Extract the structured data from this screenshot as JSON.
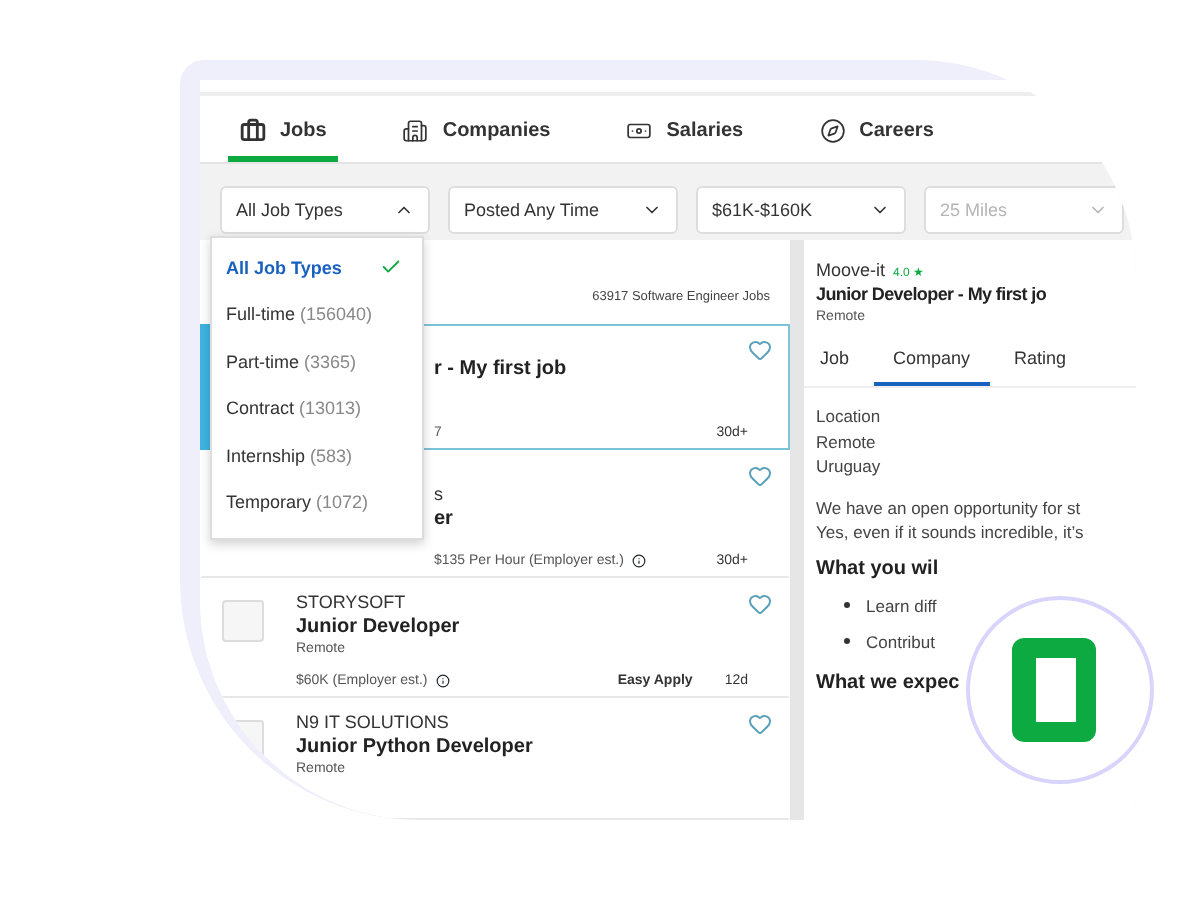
{
  "nav_tabs": [
    {
      "label": "Jobs",
      "selected": true
    },
    {
      "label": "Companies",
      "selected": false
    },
    {
      "label": "Salaries",
      "selected": false
    },
    {
      "label": "Careers",
      "selected": false
    }
  ],
  "filters": [
    {
      "label": "All Job Types",
      "expanded": true,
      "disabled": false
    },
    {
      "label": "Posted Any Time",
      "expanded": false,
      "disabled": false
    },
    {
      "label": "$61K-$160K",
      "expanded": false,
      "disabled": false
    },
    {
      "label": "25 Miles",
      "expanded": false,
      "disabled": true
    }
  ],
  "job_type_menu": [
    {
      "label": "All Job Types",
      "selected": true
    },
    {
      "label": "Full-time",
      "count": "(156040)",
      "selected": false
    },
    {
      "label": "Part-time",
      "count": "(3365)",
      "selected": false
    },
    {
      "label": "Contract",
      "count": "(13013)",
      "selected": false
    },
    {
      "label": "Internship",
      "count": "(583)",
      "selected": false
    },
    {
      "label": "Temporary",
      "count": "(1072)",
      "selected": false
    }
  ],
  "results_count": "63917 Software Engineer Jobs",
  "jobs": [
    {
      "covered": true,
      "selected": true,
      "title": "r - My first job",
      "salary": "7",
      "age": "30d+"
    },
    {
      "covered": true,
      "selected": false,
      "company": "s",
      "title": "er",
      "salary": "$135 Per Hour (Employer est.)",
      "age": "30d+"
    },
    {
      "covered": false,
      "selected": false,
      "company": "STORYSOFT",
      "title": "Junior Developer",
      "location": "Remote",
      "salary": "$60K  (Employer est.)",
      "easy_apply": "Easy Apply",
      "age": "12d"
    },
    {
      "covered": false,
      "selected": false,
      "company": "N9 IT SOLUTIONS",
      "title": "Junior Python Developer",
      "location": "Remote"
    }
  ],
  "detail": {
    "company": "Moove-it",
    "rating": "4.0 ★",
    "title": "Junior Developer - My first jo",
    "location": "Remote",
    "tabs": [
      {
        "label": "Job",
        "selected": false
      },
      {
        "label": "Company",
        "selected": true
      },
      {
        "label": "Rating",
        "selected": false
      }
    ],
    "location_lines": [
      "Location",
      "Remote",
      "Uruguay"
    ],
    "paragraph_lines": [
      "We have an open opportunity for st",
      "Yes, even if it sounds incredible, it’s"
    ],
    "heading_1": "What you wil",
    "bullets": [
      "Learn diff",
      "Contribut"
    ],
    "heading_2": "What we expec"
  }
}
